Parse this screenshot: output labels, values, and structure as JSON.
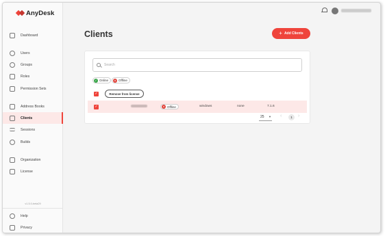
{
  "app": {
    "name": "AnyDesk"
  },
  "header": {
    "page_title": "Clients",
    "add_button": "Add Clients"
  },
  "sidebar": {
    "items": [
      {
        "label": "Dashboard"
      },
      {
        "label": "Users"
      },
      {
        "label": "Groups"
      },
      {
        "label": "Roles"
      },
      {
        "label": "Permission Sets"
      },
      {
        "label": "Address Books"
      },
      {
        "label": "Clients",
        "active": true
      },
      {
        "label": "Sessions"
      },
      {
        "label": "Builds"
      },
      {
        "label": "Organization"
      },
      {
        "label": "License"
      }
    ],
    "version": "v1.5.0-beta29",
    "footer": [
      {
        "label": "Help"
      },
      {
        "label": "Privacy"
      }
    ]
  },
  "search": {
    "placeholder": "Search",
    "value": ""
  },
  "filters": [
    {
      "label": "Online",
      "state": "online"
    },
    {
      "label": "Offline",
      "state": "offline"
    }
  ],
  "actions": {
    "remove": "Remove from license"
  },
  "table": {
    "rows": [
      {
        "selected": true,
        "status": "Offline",
        "os": "windows",
        "group": "none",
        "version": "7.1.6"
      }
    ]
  },
  "pagination": {
    "per_page": "25",
    "current_page": "1"
  },
  "colors": {
    "accent": "#ef443b",
    "online": "#3aa64a",
    "offline": "#e2453c"
  }
}
